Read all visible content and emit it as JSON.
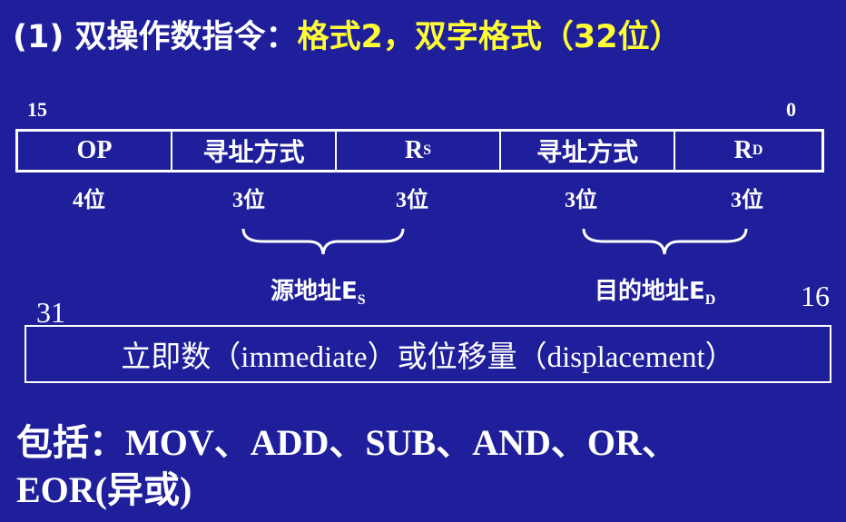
{
  "title": {
    "prefix": "(1) 双操作数指令：",
    "highlight": "格式2，双字格式（32位）"
  },
  "format_word": {
    "bit_high": "15",
    "bit_low": "0",
    "fields": [
      {
        "label": "OP",
        "sub": ""
      },
      {
        "label": "寻址方式",
        "sub": ""
      },
      {
        "label": "R",
        "sub": "S"
      },
      {
        "label": "寻址方式",
        "sub": ""
      },
      {
        "label": "R",
        "sub": "D"
      }
    ],
    "widths": [
      "4位",
      "3位",
      "3位",
      "3位",
      "3位"
    ]
  },
  "groups": [
    {
      "label": "源地址E",
      "sub": "S"
    },
    {
      "label": "目的地址E",
      "sub": "D"
    }
  ],
  "second_word": {
    "bit_high": "31",
    "bit_low": "16",
    "text": "立即数（immediate）或位移量（displacement）"
  },
  "footer": {
    "line1": "包括：MOV、ADD、SUB、AND、OR、",
    "line2": "EOR(异或)"
  },
  "colors": {
    "background": "#1f1f9c",
    "highlight": "#ffff33",
    "text": "#ffffff"
  }
}
